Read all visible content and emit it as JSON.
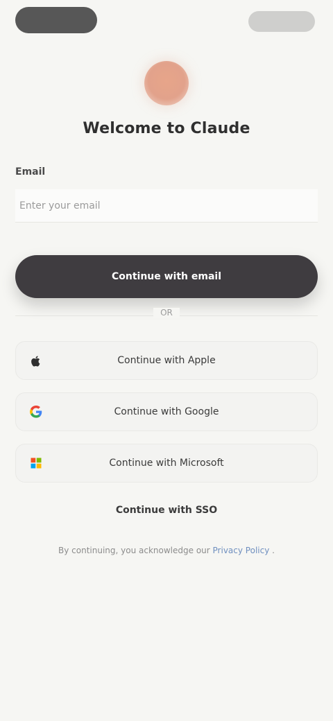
{
  "header": {
    "left_pill": "",
    "right_pill": ""
  },
  "title": "Welcome to Claude",
  "email": {
    "label": "Email",
    "placeholder": "Enter your email"
  },
  "primary_button": {
    "label": "Continue with email"
  },
  "divider": {
    "text": "OR"
  },
  "social": {
    "apple_label": "Continue with Apple",
    "google_label": "Continue with Google",
    "other_label": "Continue with Microsoft"
  },
  "links": {
    "sso_label": "Continue with SSO"
  },
  "terms": {
    "prefix": "By continuing, you acknowledge our ",
    "privacy": "Privacy Policy",
    "suffix": "."
  },
  "colors": {
    "background": "#f6f6f3",
    "primary": "#3f3c40",
    "accent": "#e2a28b",
    "link": "#6f8fbf"
  },
  "icons": {
    "apple": "apple-icon",
    "google": "google-icon",
    "microsoft": "microsoft-icon"
  }
}
